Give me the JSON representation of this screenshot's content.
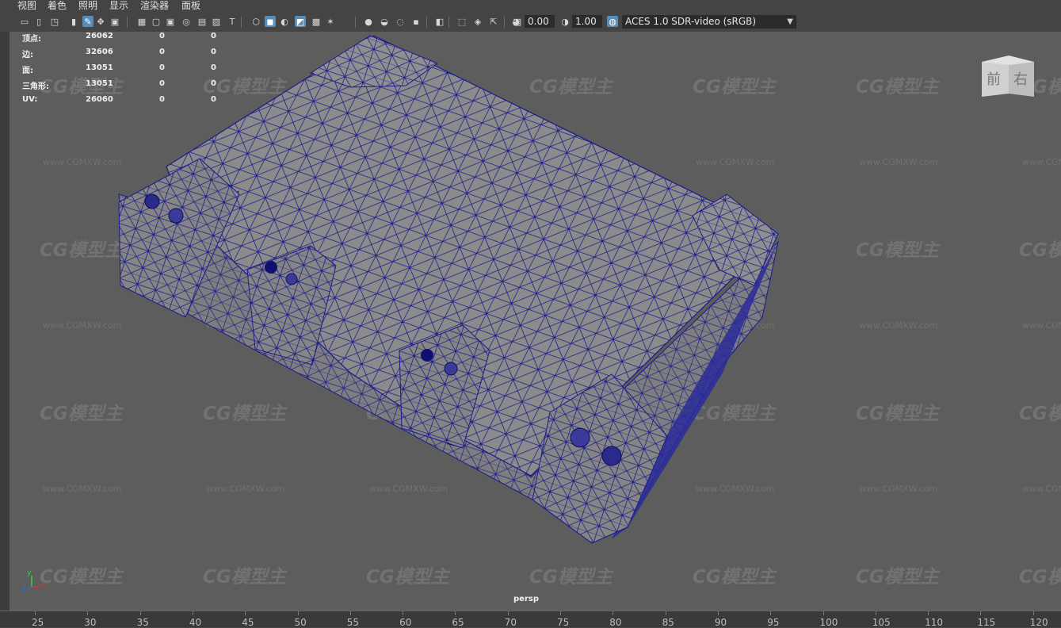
{
  "menu": [
    "视图",
    "着色",
    "照明",
    "显示",
    "渲染器",
    "面板"
  ],
  "toolbar": {
    "exposure_value": "0.00",
    "gamma_value": "1.00",
    "color_space": "ACES 1.0 SDR-video (sRGB)",
    "icons": [
      "camera-select-icon",
      "camera-attributes-icon",
      "bookmark-camera-icon",
      "bookmark-icon",
      "grease-pencil-icon",
      "2d-pan-zoom-icon",
      "image-plane-icon",
      "grid-icon",
      "film-gate-icon",
      "resolution-gate-icon",
      "gate-mask-icon",
      "field-chart-icon",
      "safe-action-icon",
      "safe-title-icon",
      "wireframe-icon",
      "smooth-shade-icon",
      "use-default-material-icon",
      "wireframe-on-shaded-icon",
      "textured-icon",
      "use-all-lights-icon",
      "shadows-icon",
      "screen-space-ao-icon",
      "motion-blur-icon",
      "anti-aliasing-icon",
      "depth-of-field-icon",
      "isolate-select-icon",
      "xray-icon",
      "xray-joints-icon",
      "xray-components-icon",
      "exposure-icon",
      "gamma-icon",
      "color-management-icon"
    ]
  },
  "hud": {
    "rows": [
      {
        "label": "顶点:",
        "count": "26062",
        "sel": "0",
        "tri": "0"
      },
      {
        "label": "边:",
        "count": "32606",
        "sel": "0",
        "tri": "0"
      },
      {
        "label": "面:",
        "count": "13051",
        "sel": "0",
        "tri": "0"
      },
      {
        "label": "三角形:",
        "count": "13051",
        "sel": "0",
        "tri": "0"
      },
      {
        "label": "UV:",
        "count": "26060",
        "sel": "0",
        "tri": "0"
      }
    ]
  },
  "viewcube": {
    "front": "前",
    "right": "右"
  },
  "camera_label": "persp",
  "axis": {
    "x": "x",
    "y": "y",
    "z": "z"
  },
  "watermark": {
    "logo": "CG模型主",
    "url": "www.CGMXW.com"
  },
  "ruler": [
    "25",
    "30",
    "35",
    "40",
    "45",
    "50",
    "55",
    "60",
    "65",
    "70",
    "75",
    "80",
    "85",
    "90",
    "95",
    "100",
    "105",
    "110",
    "115",
    "120"
  ],
  "colors": {
    "wire": "#1a1a8c",
    "surface": "#8a8a8a",
    "background": "#5d5d5d"
  }
}
